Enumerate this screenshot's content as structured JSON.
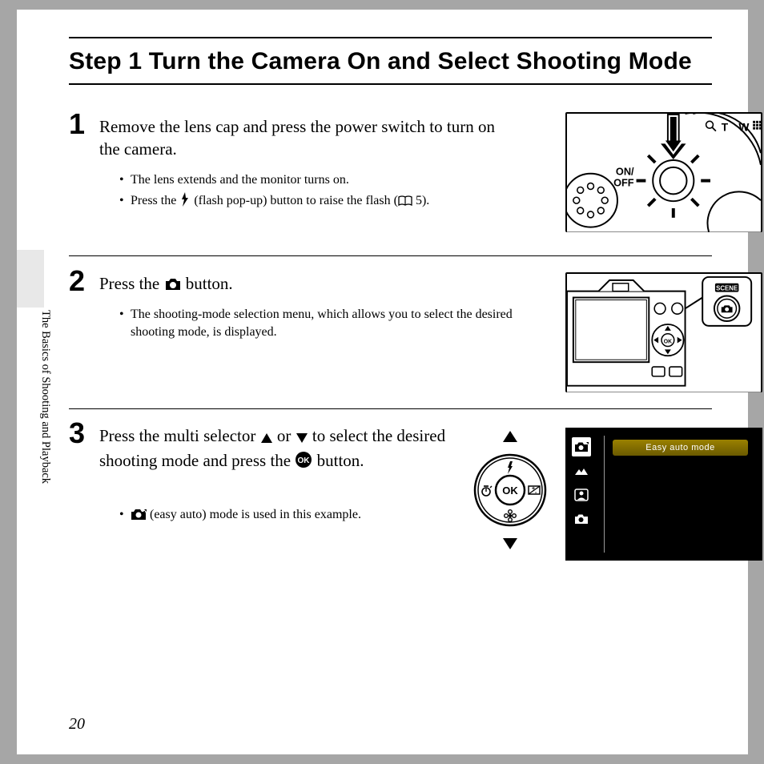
{
  "title": "Step 1 Turn the Camera On and Select Shooting Mode",
  "side_label": "The Basics of Shooting and Playback",
  "page_number": "20",
  "step1": {
    "num": "1",
    "head": "Remove the lens cap and press the power switch to turn on the camera.",
    "b1": "The lens extends and the monitor turns on.",
    "b2a": "Press the ",
    "b2b": " (flash pop-up) button to raise the flash (",
    "b2_ref": " 5)."
  },
  "step2": {
    "num": "2",
    "head_a": "Press the ",
    "head_b": " button.",
    "b1": "The shooting-mode selection menu, which allows you to select the desired shooting mode, is displayed."
  },
  "step3": {
    "num": "3",
    "head_a": "Press the multi selector ",
    "head_b": " or ",
    "head_c": " to select the desired shooting mode and press the ",
    "head_d": " button.",
    "b1_b": " (easy auto) mode is used in this example."
  },
  "fig1": {
    "onoff": "ON/\nOFF",
    "t": "T",
    "w": "W"
  },
  "fig2": {
    "scene": "SCENE"
  },
  "menu": {
    "label": "Easy auto mode"
  },
  "selector": {
    "ok": "OK"
  }
}
